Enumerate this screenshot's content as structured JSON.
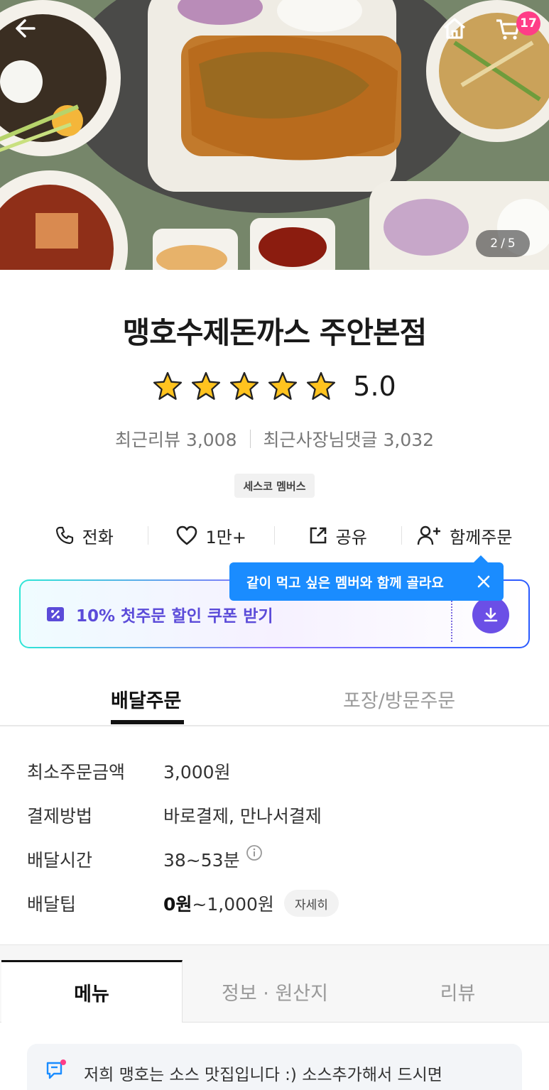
{
  "header": {
    "cart_count": "17",
    "page_indicator": {
      "current": "2",
      "sep": "/",
      "total": "5"
    }
  },
  "store": {
    "name": "맹호수제돈까스 주안본점",
    "rating": "5.0",
    "stars": 5,
    "recent_review_label": "최근리뷰",
    "recent_review_count": "3,008",
    "owner_reply_label": "최근사장님댓글",
    "owner_reply_count": "3,032",
    "member_badge": "세스코 멤버스"
  },
  "actions": [
    {
      "icon": "phone-icon",
      "label": "전화"
    },
    {
      "icon": "heart-icon",
      "label": "1만+"
    },
    {
      "icon": "share-icon",
      "label": "공유"
    },
    {
      "icon": "group-order-icon",
      "label": "함께주문"
    }
  ],
  "tooltip": {
    "text": "같이 먹고 싶은 멤버와 함께 골라요"
  },
  "coupon": {
    "label": "10% 첫주문 할인 쿠폰 받기"
  },
  "order_tabs": [
    "배달주문",
    "포장/방문주문"
  ],
  "info": {
    "min_order_label": "최소주문금액",
    "min_order_value": "3,000원",
    "payment_label": "결제방법",
    "payment_value": "바로결제, 만나서결제",
    "time_label": "배달시간",
    "time_value": "38~53분",
    "tip_label": "배달팁",
    "tip_min": "0원",
    "tip_rest": "~1,000원",
    "tip_detail_button": "자세히"
  },
  "menu_tabs": [
    "메뉴",
    "정보 · 원산지",
    "리뷰"
  ],
  "notice": {
    "text": "저희 맹호는 소스 맛집입니다 :) 소스추가해서 드시면"
  },
  "colors": {
    "accent_blue": "#1a8cff",
    "coupon_purple": "#6b4fe6",
    "badge_pink": "#ff3d87"
  }
}
